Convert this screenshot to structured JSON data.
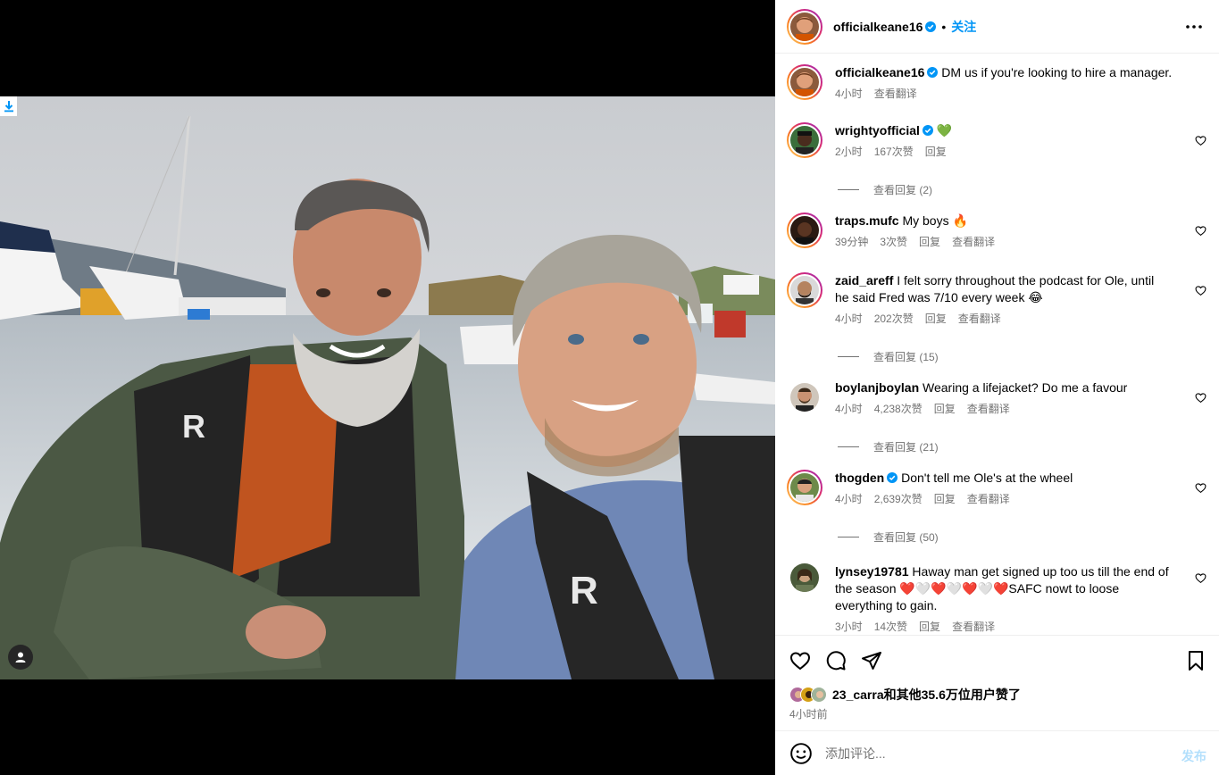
{
  "post": {
    "author": "officialkeane16",
    "follow_label": "关注",
    "separator": "•",
    "icons": {
      "more": "more-horizontal-icon",
      "download": "download-icon",
      "tag": "user-tag-icon",
      "verified": "verified-badge-icon"
    }
  },
  "caption": {
    "username": "officialkeane16",
    "text": "DM us if you're looking to hire a manager.",
    "time": "4小时",
    "translate": "查看翻译"
  },
  "comments": [
    {
      "username": "wrightyofficial",
      "verified": true,
      "text": "💚",
      "time": "2小时",
      "likes": "167次赞",
      "reply": "回复",
      "translate": "",
      "view_replies": "查看回复 (2)"
    },
    {
      "username": "traps.mufc",
      "verified": false,
      "text": "My boys 🔥",
      "time": "39分钟",
      "likes": "3次赞",
      "reply": "回复",
      "translate": "查看翻译",
      "view_replies": ""
    },
    {
      "username": "zaid_areff",
      "verified": false,
      "text": "I felt sorry throughout the podcast for Ole, until he said Fred was 7/10 every week 😂",
      "time": "4小时",
      "likes": "202次赞",
      "reply": "回复",
      "translate": "查看翻译",
      "view_replies": "查看回复 (15)"
    },
    {
      "username": "boylanjboylan",
      "verified": false,
      "text": "Wearing a lifejacket? Do me a favour",
      "time": "4小时",
      "likes": "4,238次赞",
      "reply": "回复",
      "translate": "查看翻译",
      "view_replies": "查看回复 (21)"
    },
    {
      "username": "thogden",
      "verified": true,
      "text": "Don't tell me Ole's at the wheel",
      "time": "4小时",
      "likes": "2,639次赞",
      "reply": "回复",
      "translate": "查看翻译",
      "view_replies": "查看回复 (50)"
    },
    {
      "username": "lynsey19781",
      "verified": false,
      "text": "Haway man get signed up too us till the end of the season ❤️🤍❤️🤍❤️🤍❤️SAFC nowt to loose everything to gain.",
      "time": "3小时",
      "likes": "14次赞",
      "reply": "回复",
      "translate": "查看翻译",
      "view_replies": ""
    }
  ],
  "actions": {
    "icons": [
      "heart-icon",
      "comment-icon",
      "share-icon",
      "bookmark-icon"
    ],
    "likes_text": "23_carra和其他35.6万位用户赞了",
    "post_time": "4小时前"
  },
  "composer": {
    "placeholder": "添加评论...",
    "post_label": "发布",
    "emoji_icon": "emoji-icon"
  },
  "colors": {
    "accent": "#0095f6",
    "muted": "#737373",
    "verified": "#0095f6",
    "heart_green": "#2ecc40"
  }
}
